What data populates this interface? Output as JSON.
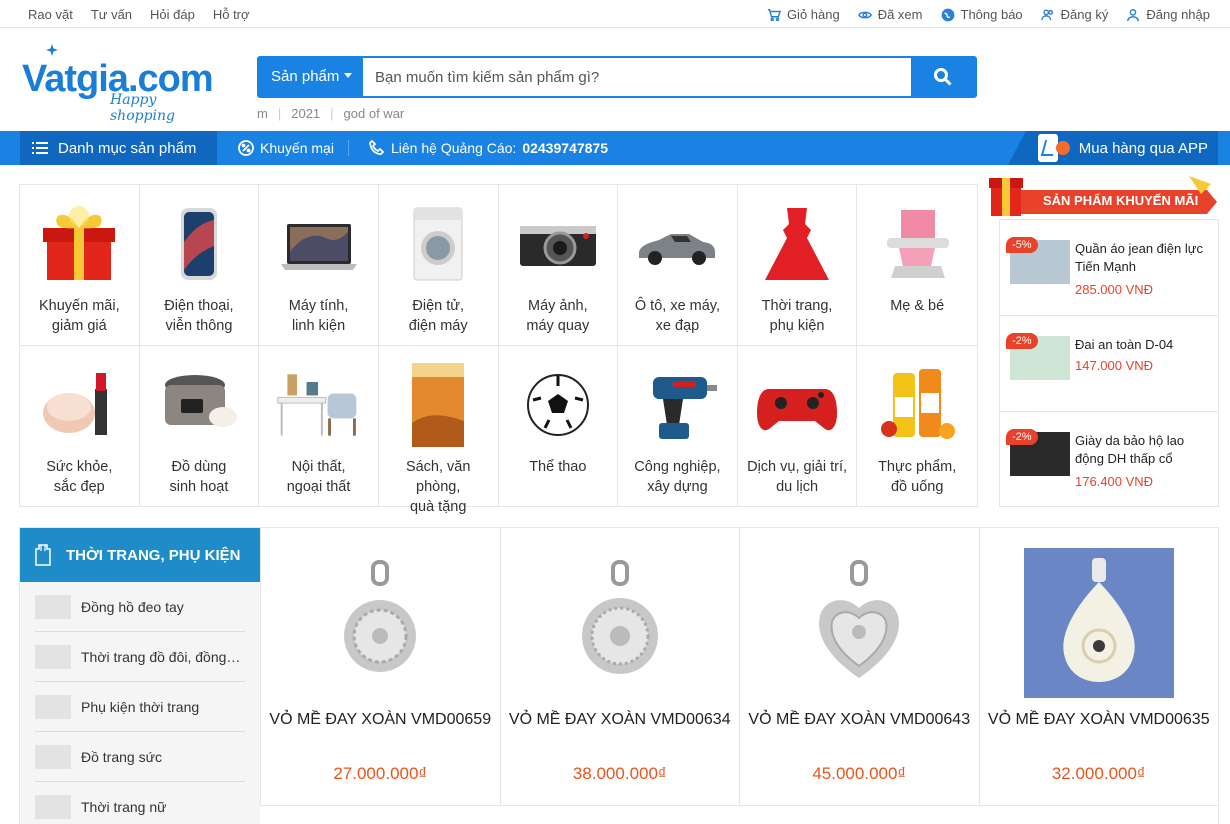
{
  "topbar": {
    "left_links": [
      "Rao vặt",
      "Tư vấn",
      "Hỏi đáp",
      "Hỗ trợ"
    ],
    "cart": "Giỏ hàng",
    "viewed": "Đã xem",
    "notify": "Thông báo",
    "register": "Đăng ký",
    "login": "Đăng nhập"
  },
  "logo": {
    "text": "Vatgia.com",
    "tagline": "Happy shopping"
  },
  "search": {
    "category": "Sản phẩm",
    "placeholder": "Bạn muốn tìm kiếm sản phẩm gì?",
    "suggestions": [
      "m",
      "2021",
      "god of war"
    ]
  },
  "nav": {
    "categories": "Danh mục sản phẩm",
    "promotions": "Khuyến mại",
    "hotline_label": "Liên hệ Quảng Cáo:",
    "hotline_number": "02439747875",
    "app": "Mua hàng qua APP"
  },
  "categories": [
    {
      "line1": "Khuyến mãi,",
      "line2": "giảm giá",
      "icon": "gift-icon"
    },
    {
      "line1": "Điện thoại,",
      "line2": "viễn thông",
      "icon": "phone-icon"
    },
    {
      "line1": "Máy tính,",
      "line2": "linh kiện",
      "icon": "laptop-icon"
    },
    {
      "line1": "Điện tử,",
      "line2": "điện máy",
      "icon": "washing-machine-icon"
    },
    {
      "line1": "Máy ảnh,",
      "line2": "máy quay",
      "icon": "camera-icon"
    },
    {
      "line1": "Ô tô, xe máy,",
      "line2": "xe đạp",
      "icon": "car-icon"
    },
    {
      "line1": "Thời trang,",
      "line2": "phụ kiện",
      "icon": "dress-icon"
    },
    {
      "line1": "Mẹ & bé",
      "line2": "",
      "icon": "baby-chair-icon"
    },
    {
      "line1": "Sức khỏe,",
      "line2": "sắc đẹp",
      "icon": "cosmetics-icon"
    },
    {
      "line1": "Đồ dùng",
      "line2": "sinh hoạt",
      "icon": "rice-cooker-icon"
    },
    {
      "line1": "Nội thất,",
      "line2": "ngoại thất",
      "icon": "furniture-icon"
    },
    {
      "line1": "Sách, văn phòng,",
      "line2": "quà tặng",
      "icon": "book-icon"
    },
    {
      "line1": "Thể thao",
      "line2": "",
      "icon": "soccer-ball-icon"
    },
    {
      "line1": "Công nghiệp,",
      "line2": "xây dựng",
      "icon": "drill-icon"
    },
    {
      "line1": "Dịch vụ, giải trí,",
      "line2": "du lịch",
      "icon": "gamepad-icon"
    },
    {
      "line1": "Thực phẩm,",
      "line2": "đồ uống",
      "icon": "juice-icon"
    }
  ],
  "promo": {
    "title": "SẢN PHẨM KHUYẾN MÃI",
    "items": [
      {
        "badge": "-5%",
        "name": "Quần áo jean điện lực Tiến Mạnh",
        "price": "285.000 VNĐ"
      },
      {
        "badge": "-2%",
        "name": "Đai an toàn D-04",
        "price": "147.000 VNĐ"
      },
      {
        "badge": "-2%",
        "name": "Giày da bảo hộ lao động DH thấp cổ",
        "price": "176.400 VNĐ"
      }
    ]
  },
  "section": {
    "title": "THỜI TRANG, PHỤ KIỆN",
    "subcats": [
      "Đồng hồ đeo tay",
      "Thời trang đồ đôi, đồng phục",
      "Phụ kiện thời trang",
      "Đồ trang sức",
      "Thời trang nữ"
    ],
    "products": [
      {
        "name": "VỎ MỀ ĐAY XOÀN VMD00659",
        "price": "27.000.000₫"
      },
      {
        "name": "VỎ MỀ ĐAY XOÀN VMD00634",
        "price": "38.000.000₫"
      },
      {
        "name": "VỎ MỀ ĐAY XOÀN VMD00643",
        "price": "45.000.000₫"
      },
      {
        "name": "VỎ MỀ ĐAY XOÀN VMD00635",
        "price": "32.000.000₫"
      }
    ]
  },
  "colors": {
    "primary": "#1a82e2",
    "dark_primary": "#0f67bf",
    "price": "#e8561e",
    "badge": "#e8422a",
    "section": "#1d8cc9"
  }
}
